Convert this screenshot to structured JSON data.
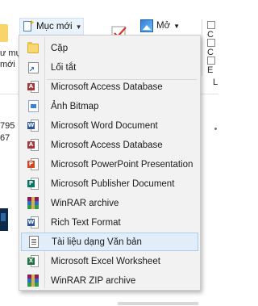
{
  "ribbon": {
    "new_item_label": "Mục mới",
    "open_label": "Mở",
    "left_labels": [
      "ư mụ",
      "mới"
    ],
    "right_labels": [
      "C",
      "C",
      "E"
    ],
    "right_small": "L",
    "numbers": [
      "795",
      "67"
    ]
  },
  "menu": {
    "items": [
      {
        "label": "Cặp",
        "icon": "folder-icon"
      },
      {
        "label": "Lối tắt",
        "icon": "shortcut-icon"
      },
      {
        "label": "Microsoft Access Database",
        "icon": "access-icon"
      },
      {
        "label": "Ảnh Bitmap",
        "icon": "bitmap-icon"
      },
      {
        "label": "Microsoft Word Document",
        "icon": "word-icon"
      },
      {
        "label": "Microsoft Access Database",
        "icon": "access-icon"
      },
      {
        "label": "Microsoft PowerPoint Presentation",
        "icon": "powerpoint-icon"
      },
      {
        "label": "Microsoft Publisher Document",
        "icon": "publisher-icon"
      },
      {
        "label": "WinRAR archive",
        "icon": "winrar-icon"
      },
      {
        "label": "Rich Text Format",
        "icon": "rtf-icon"
      },
      {
        "label": "Tài liệu dạng Văn bản",
        "icon": "text-document-icon"
      },
      {
        "label": "Microsoft Excel Worksheet",
        "icon": "excel-icon"
      },
      {
        "label": "WinRAR ZIP archive",
        "icon": "winrar-zip-icon"
      }
    ],
    "highlighted_index": 10
  },
  "colors": {
    "highlight_bg": "#e1edf9",
    "highlight_border": "#a9ccef",
    "menu_bg": "#f2f2f2",
    "access": "#a4373a",
    "word": "#2b579a",
    "powerpoint": "#d24726",
    "publisher": "#077568",
    "excel": "#217346"
  }
}
